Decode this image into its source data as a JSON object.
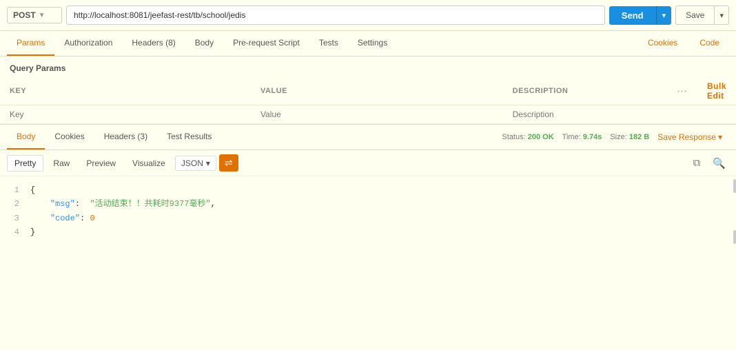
{
  "topbar": {
    "method": "POST",
    "method_chevron": "▼",
    "url": "http://localhost:8081/jeefast-rest/tb/school/jedis",
    "send_label": "Send",
    "send_chevron": "▾",
    "save_label": "Save",
    "save_chevron": "▾"
  },
  "request_tabs": [
    {
      "id": "params",
      "label": "Params",
      "active": true
    },
    {
      "id": "authorization",
      "label": "Authorization",
      "active": false
    },
    {
      "id": "headers",
      "label": "Headers (8)",
      "active": false
    },
    {
      "id": "body",
      "label": "Body",
      "active": false
    },
    {
      "id": "prerequest",
      "label": "Pre-request Script",
      "active": false
    },
    {
      "id": "tests",
      "label": "Tests",
      "active": false
    },
    {
      "id": "settings",
      "label": "Settings",
      "active": false
    }
  ],
  "request_tabs_right": [
    {
      "id": "cookies",
      "label": "Cookies"
    },
    {
      "id": "code",
      "label": "Code"
    }
  ],
  "query_params": {
    "section_title": "Query Params",
    "columns": [
      {
        "id": "key",
        "label": "KEY"
      },
      {
        "id": "value",
        "label": "VALUE"
      },
      {
        "id": "description",
        "label": "DESCRIPTION"
      }
    ],
    "bulk_edit_label": "Bulk Edit",
    "placeholder_row": {
      "key": "Key",
      "value": "Value",
      "description": "Description"
    }
  },
  "response_tabs": [
    {
      "id": "body",
      "label": "Body",
      "active": true
    },
    {
      "id": "cookies",
      "label": "Cookies",
      "active": false
    },
    {
      "id": "headers",
      "label": "Headers (3)",
      "active": false
    },
    {
      "id": "test_results",
      "label": "Test Results",
      "active": false
    }
  ],
  "response_status": {
    "status_label": "Status:",
    "status_value": "200 OK",
    "time_label": "Time:",
    "time_value": "9.74s",
    "size_label": "Size:",
    "size_value": "182 B",
    "save_response_label": "Save Response",
    "save_response_chevron": "▾"
  },
  "code_toolbar": {
    "views": [
      {
        "id": "pretty",
        "label": "Pretty",
        "active": true
      },
      {
        "id": "raw",
        "label": "Raw",
        "active": false
      },
      {
        "id": "preview",
        "label": "Preview",
        "active": false
      },
      {
        "id": "visualize",
        "label": "Visualize",
        "active": false
      }
    ],
    "format": "JSON",
    "format_chevron": "▾",
    "wrap_icon": "⇌"
  },
  "json_response": {
    "lines": [
      {
        "num": "1",
        "content": "{"
      },
      {
        "num": "2",
        "content": "    \"msg\":  \"活动结束！！共耗时9377毫秒\","
      },
      {
        "num": "3",
        "content": "    \"code\": 0"
      },
      {
        "num": "4",
        "content": "}"
      }
    ]
  }
}
